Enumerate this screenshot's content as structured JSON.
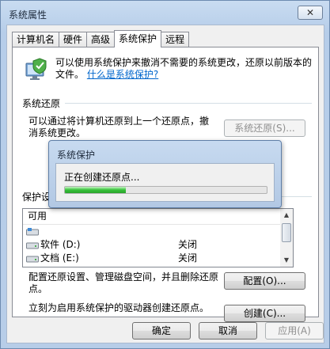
{
  "window": {
    "title": "系统属性",
    "close_glyph": "✕"
  },
  "tabs": [
    {
      "label": "计算机名",
      "active": false
    },
    {
      "label": "硬件",
      "active": false
    },
    {
      "label": "高级",
      "active": false
    },
    {
      "label": "系统保护",
      "active": true
    },
    {
      "label": "远程",
      "active": false
    }
  ],
  "intro": {
    "text": "可以使用系统保护来撤消不需要的系统更改，还原以前版本的文件。",
    "link": "什么是系统保护?"
  },
  "restore": {
    "title": "系统还原",
    "desc": "可以通过将计算机还原到上一个还原点，撤消系统更改。",
    "button": "系统还原(S)..."
  },
  "protection": {
    "title": "保护设",
    "header": "可用",
    "rows": [
      {
        "name": "",
        "status": ""
      },
      {
        "name": "软件  (D:)",
        "status": "关闭"
      },
      {
        "name": "文档  (E:)",
        "status": "关闭"
      }
    ]
  },
  "configure": {
    "desc": "配置还原设置、管理磁盘空间，并且删除还原点。",
    "button": "配置(O)..."
  },
  "create": {
    "desc": "立刻为启用系统保护的驱动器创建还原点。",
    "button": "创建(C)..."
  },
  "footer": {
    "ok": "确定",
    "cancel": "取消",
    "apply": "应用(A)"
  },
  "popup": {
    "title": "系统保护",
    "message": "正在创建还原点...",
    "progress": 0.3
  },
  "colors": {
    "accent_link": "#0066cc",
    "progress_green": "#37c139"
  }
}
